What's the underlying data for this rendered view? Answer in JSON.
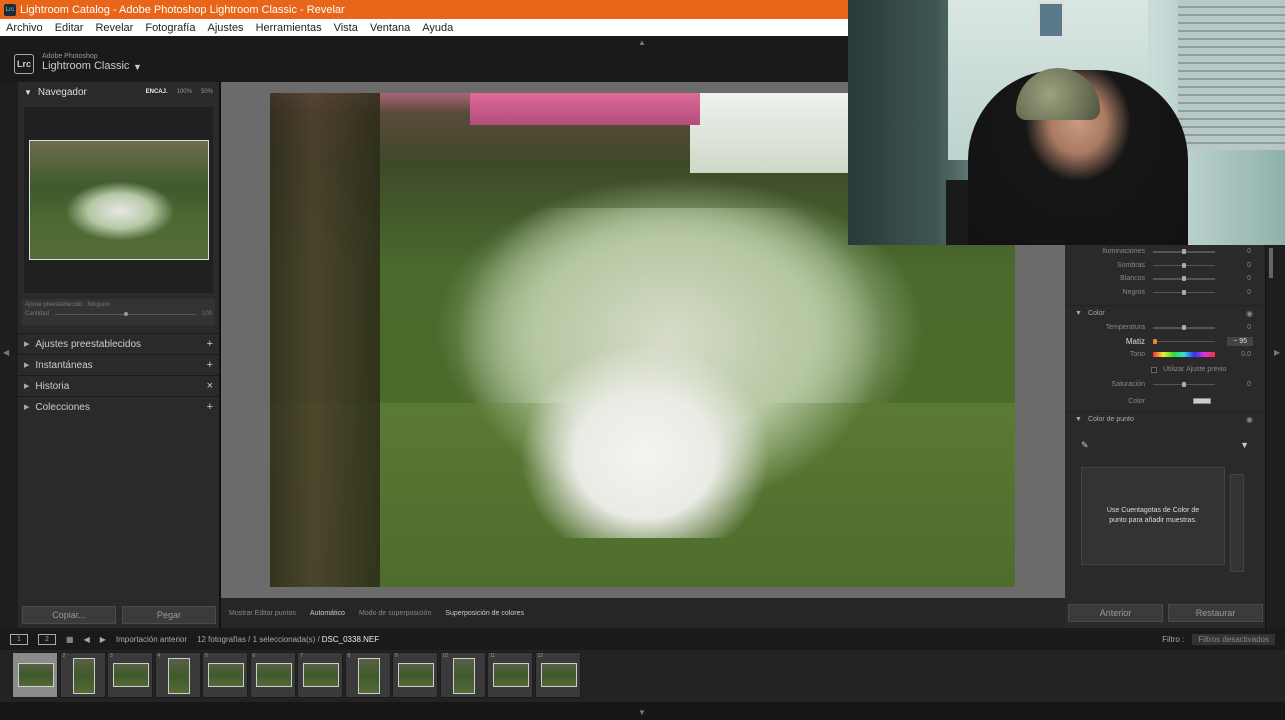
{
  "window": {
    "title": "Lightroom Catalog - Adobe Photoshop Lightroom Classic - Revelar",
    "icon_text": "Lrc"
  },
  "menu": [
    "Archivo",
    "Editar",
    "Revelar",
    "Fotografía",
    "Ajustes",
    "Herramientas",
    "Vista",
    "Ventana",
    "Ayuda"
  ],
  "brand": {
    "small": "Adobe Photoshop",
    "name": "Lightroom Classic",
    "logo": "Lrc",
    "caret": "▼"
  },
  "navigator": {
    "title": "Navegador",
    "zoom": [
      "ENCAJ.",
      "100%",
      "50%"
    ]
  },
  "preset_amount": {
    "label": "Ajuste preestablecido : Ninguno",
    "amount_label": "Cantidad",
    "value": "100",
    "fraction": 0.5
  },
  "left_sections": [
    {
      "label": "Ajustes preestablecidos",
      "action": "+"
    },
    {
      "label": "Instantáneas",
      "action": "+"
    },
    {
      "label": "Historia",
      "action": "×"
    },
    {
      "label": "Colecciones",
      "action": "+"
    }
  ],
  "left_buttons": {
    "copy": "Copiar...",
    "paste": "Pegar"
  },
  "toolbar": {
    "show_edit_points": "Mostrar Editar puntos",
    "auto": "Automático",
    "overlay_mode": "Modo de superposición",
    "color_overlay": "Superposición de colores"
  },
  "tone": [
    {
      "label": "Iluminaciones",
      "value": "0",
      "fraction": 0.5
    },
    {
      "label": "Sombras",
      "value": "0",
      "fraction": 0.5
    },
    {
      "label": "Blancos",
      "value": "0",
      "fraction": 0.5
    },
    {
      "label": "Negros",
      "value": "0",
      "fraction": 0.5
    }
  ],
  "color": {
    "title": "Color",
    "temperatura": {
      "label": "Temperatura",
      "value": "0",
      "fraction": 0.5
    },
    "matiz": {
      "label": "Matiz",
      "value": "− 95",
      "fraction": 0.03
    },
    "tono_label": "Tono",
    "tono_value": "0,0",
    "use_preset": "Utilizar Ajuste previo",
    "saturacion": {
      "label": "Saturación",
      "value": "0",
      "fraction": 0.5
    },
    "color_label": "Color"
  },
  "point_color": {
    "title": "Color de punto",
    "hint": "Use Cuentagotas de Color de punto para añadir muestras."
  },
  "right_buttons": {
    "previous": "Anterior",
    "reset": "Restaurar"
  },
  "filmbar": {
    "screen1": "1",
    "screen2": "2",
    "source": "Importación anterior",
    "count": "12 fotografías / 1 seleccionada(s) /",
    "filename": "DSC_0338.NEF",
    "filter_label": "Filtro :",
    "filter_value": "Filtros desactivados"
  },
  "filmstrip": [
    {
      "n": "1",
      "v": false
    },
    {
      "n": "2",
      "v": true
    },
    {
      "n": "3",
      "v": false
    },
    {
      "n": "4",
      "v": true
    },
    {
      "n": "5",
      "v": false
    },
    {
      "n": "6",
      "v": false
    },
    {
      "n": "7",
      "v": false
    },
    {
      "n": "8",
      "v": true
    },
    {
      "n": "9",
      "v": false
    },
    {
      "n": "10",
      "v": true
    },
    {
      "n": "11",
      "v": false
    },
    {
      "n": "12",
      "v": false
    }
  ],
  "colors": {
    "titlebar": "#e8651a",
    "panel": "#2a2a2a",
    "canvas": "#6b6b6b"
  }
}
